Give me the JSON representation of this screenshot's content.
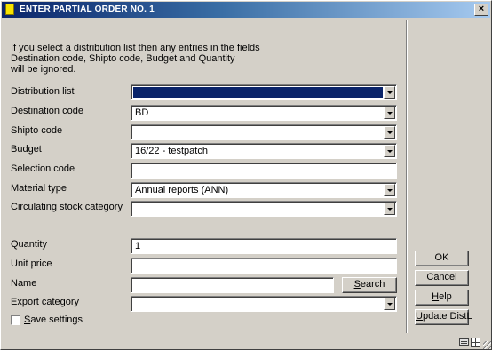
{
  "window": {
    "title": "ENTER PARTIAL ORDER NO. 1",
    "close_label": "×"
  },
  "info": {
    "line1": "If you select a distribution list then any entries in the fields",
    "line2": "Destination code, Shipto code, Budget and Quantity",
    "line3": "will be ignored."
  },
  "form": {
    "distribution_list": {
      "label": "Distribution list",
      "value": ""
    },
    "destination_code": {
      "label": "Destination code",
      "value": "BD"
    },
    "shipto_code": {
      "label": "Shipto code",
      "value": ""
    },
    "budget": {
      "label": "Budget",
      "value": "16/22 - testpatch"
    },
    "selection_code": {
      "label": "Selection code",
      "value": ""
    },
    "material_type": {
      "label": "Material type",
      "value": "Annual reports (ANN)"
    },
    "circulating_stock_category": {
      "label": "Circulating stock category",
      "value": ""
    },
    "quantity": {
      "label": "Quantity",
      "value": "1"
    },
    "unit_price": {
      "label": "Unit price",
      "value": ""
    },
    "name": {
      "label": "Name",
      "value": ""
    },
    "export_category": {
      "label": "Export category",
      "value": ""
    },
    "save_settings": {
      "label_rest": "ave settings",
      "label_underlined": "S",
      "checked": false
    }
  },
  "buttons": {
    "search": {
      "underlined": "S",
      "rest": "earch"
    },
    "ok": "OK",
    "cancel": "Cancel",
    "help": {
      "underlined": "H",
      "rest": "elp"
    },
    "update_distl": {
      "underlined": "U",
      "rest": "pdate DistL"
    }
  },
  "colors": {
    "titlebar_start": "#0a246a",
    "titlebar_end": "#a6caf0",
    "face": "#d4d0c8",
    "selection": "#0a246a"
  },
  "icons": {
    "title": "app-icon",
    "keyboard": "keyboard-icon",
    "grid": "grid-icon",
    "resize": "resize-grip-icon"
  }
}
